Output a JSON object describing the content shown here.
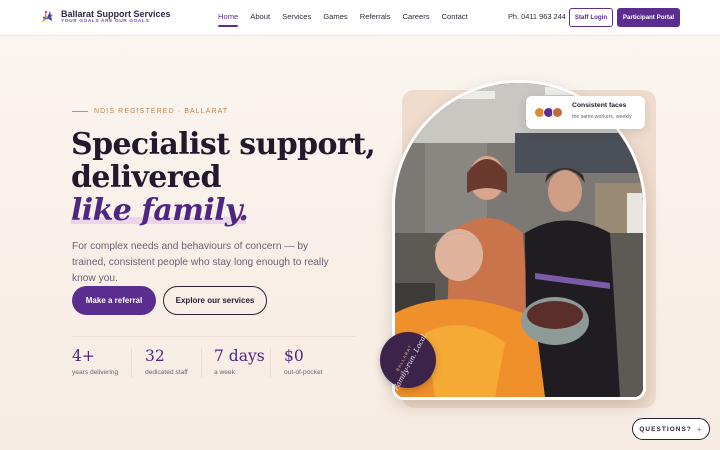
{
  "nav": {
    "brand_name": "Ballarat Support Services",
    "brand_tagline": "YOUR GOALS ARE OUR GOALS",
    "links": [
      "Home",
      "About",
      "Services",
      "Games",
      "Referrals",
      "Careers",
      "Contact"
    ],
    "active_link": "Home",
    "phone": "Ph. 0411 963 244",
    "staff_login": "Staff Login",
    "participant_portal": "Participant Portal"
  },
  "hero": {
    "eyebrow": "NDIS REGISTERED · BALLARAT",
    "headline_line1": "Specialist support,",
    "headline_line2": "delivered",
    "headline_line3": "like family.",
    "subtext": "For complex needs and behaviours of concern — by trained, consistent people who stay long enough to really know you.",
    "cta_primary": "Make a referral",
    "cta_secondary": "Explore our services"
  },
  "stats": [
    {
      "value": "4+",
      "label": "years delivering"
    },
    {
      "value": "32",
      "label": "dedicated staff"
    },
    {
      "value": "7 days",
      "label": "a week"
    },
    {
      "value": "$0",
      "label": "out-of-pocket"
    }
  ],
  "chip": {
    "title": "Consistent faces",
    "subtitle": "the same workers, weekly"
  },
  "badge": {
    "small": "BALLARAT",
    "big": "Family-run. Local."
  },
  "questions_button": "QUESTIONS?",
  "colors": {
    "accent": "#5b2d8e",
    "eyebrow": "#c4834e",
    "background": "#fbf6f2"
  }
}
